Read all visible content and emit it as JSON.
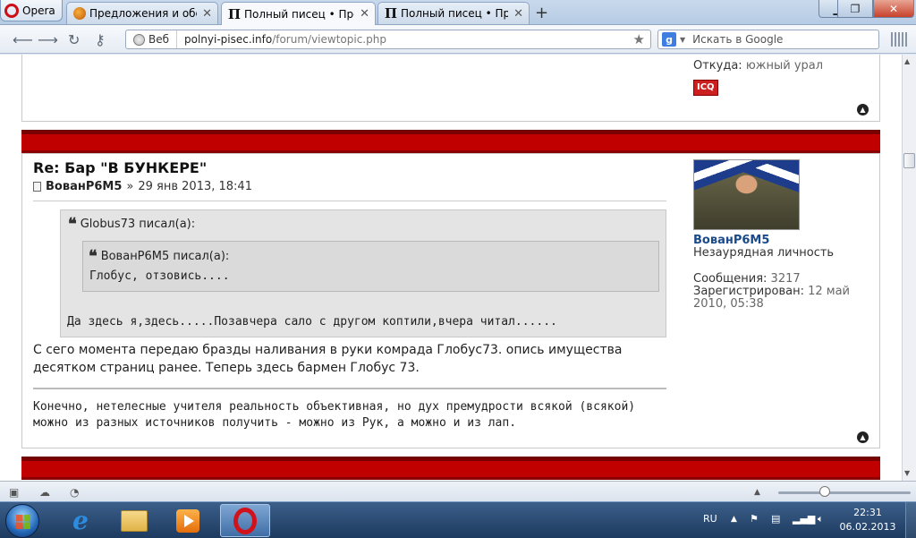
{
  "browser": {
    "app_button": "Opera",
    "tabs": [
      {
        "label": "Предложения и обсу..."
      },
      {
        "label": "Полный писец • Прос..."
      },
      {
        "label": "Полный писец • Прос..."
      }
    ],
    "new_tab": "+",
    "address": {
      "badge": "Веб",
      "host": "polnyi-pisec.info",
      "path": "/forum/viewtopic.php"
    },
    "search_placeholder": "Искать в Google"
  },
  "prev_post": {
    "from_label": "Откуда:",
    "from_value": "южный урал",
    "icq": "ICQ"
  },
  "post": {
    "title": "Re: Бар \"В БУНКЕРЕ\"",
    "author": "ВованР6М5",
    "separator": "»",
    "date": "29 янв 2013, 18:41",
    "quote_outer": {
      "author_line": "Globus73 писал(а):",
      "text": "Да здесь я,здесь.....Позавчера сало с другом коптили,вчера читал......"
    },
    "quote_inner": {
      "author_line": "ВованР6М5 писал(а):",
      "text": "Глобус, отзовись...."
    },
    "body_line1": "С сего момента передаю бразды наливания в руки комрада Глобус73. опись имущества",
    "body_line2": "десятком страниц ранее. Теперь здесь бармен Глобус 73.",
    "signature_line1": "Конечно, нетелесные учителя реальность объективная, но дух премудрости всякой (всякой)",
    "signature_line2": "можно из разных источников получить - можно из Рук, а можно и из лап.",
    "profile": {
      "username": "ВованР6М5",
      "rank": "Незаурядная личность",
      "posts_label": "Сообщения:",
      "posts_value": "3217",
      "registered_label": "Зарегистрирован:",
      "registered_value_1": "12 май",
      "registered_value_2": "2010, 05:38"
    }
  },
  "taskbar": {
    "language": "RU",
    "time": "22:31",
    "date": "06.02.2013"
  },
  "colors": {
    "post_header_bar": "#c00000",
    "username": "#1a4a8a"
  }
}
